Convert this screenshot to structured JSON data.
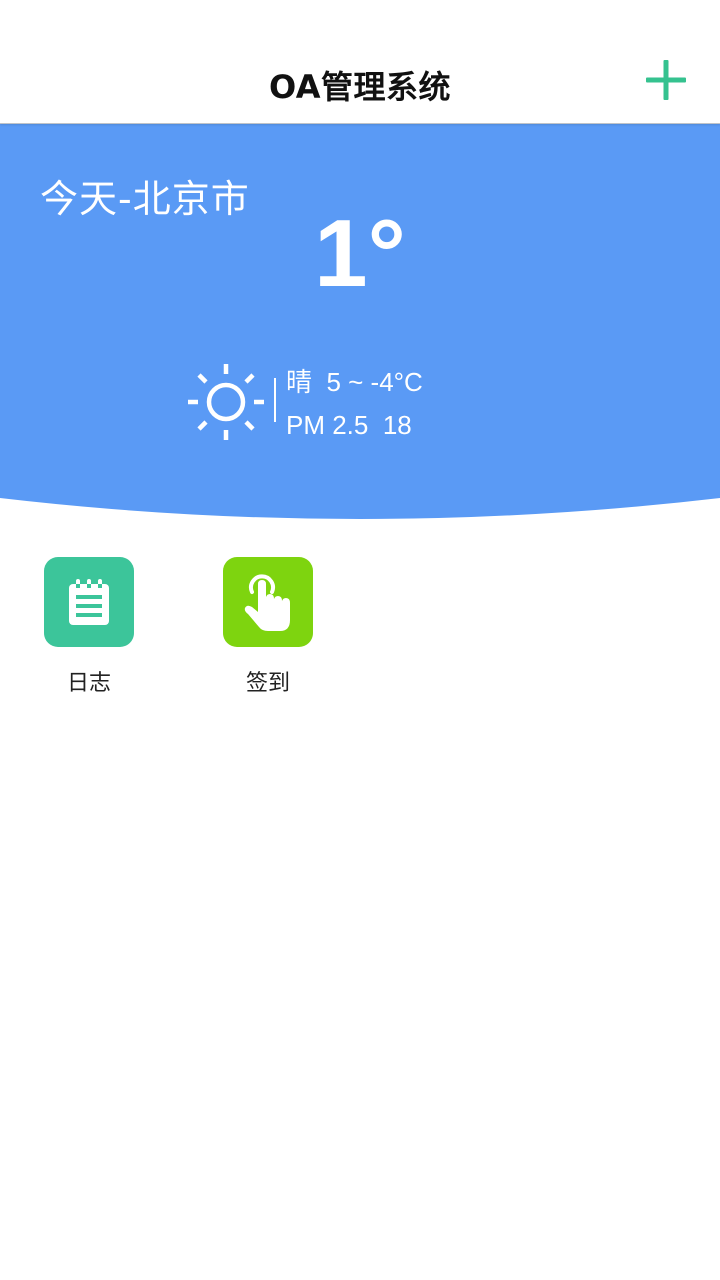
{
  "header": {
    "title": "OA管理系统",
    "add_icon": "plus-icon",
    "accent_color": "#35c28f"
  },
  "weather": {
    "background_color": "#5a9af5",
    "city": "今天-北京市",
    "temperature": "1°",
    "condition_icon": "sun-icon",
    "condition": "晴  5 ~ -4°C",
    "pm": "PM 2.5  18"
  },
  "apps": [
    {
      "label": "日志",
      "icon": "notepad-icon",
      "color": "#3cc59a"
    },
    {
      "label": "签到",
      "icon": "tap-hand-icon",
      "color": "#7ed40f"
    }
  ]
}
